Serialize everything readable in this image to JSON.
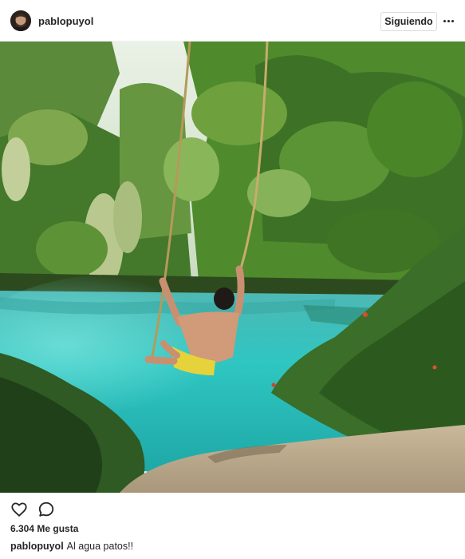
{
  "header": {
    "username": "pablopuyol",
    "follow_label": "Siguiendo",
    "more_icon": "more-horizontal-icon"
  },
  "photo": {
    "subject": "photo"
  },
  "actions": {
    "like_icon": "heart-icon",
    "comment_icon": "comment-icon"
  },
  "likes": {
    "text": "6.304 Me gusta"
  },
  "caption": {
    "username": "pablopuyol",
    "text": "Al agua patos!!"
  },
  "colors": {
    "text": "#262626",
    "border": "#dbdbdb",
    "water": "#2ec4c0",
    "foliage": "#3f7a2a"
  }
}
